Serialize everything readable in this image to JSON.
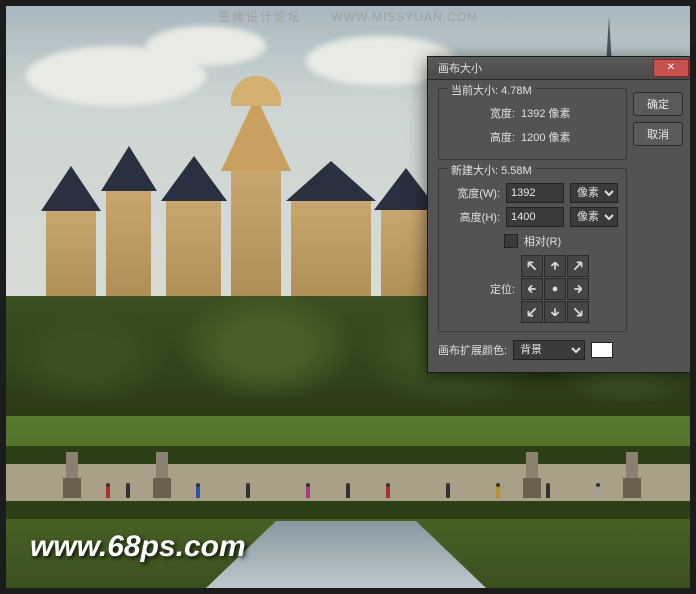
{
  "watermark": {
    "top_left": "思缘设计论坛",
    "top_right": "WWW.MISSYUAN.COM",
    "bottom": "www.68ps.com"
  },
  "dialog": {
    "title": "画布大小",
    "ok": "确定",
    "cancel": "取消",
    "current": {
      "heading": "当前大小:",
      "size": "4.78M",
      "width_label": "宽度:",
      "width_value": "1392 像素",
      "height_label": "高度:",
      "height_value": "1200 像素"
    },
    "new": {
      "heading": "新建大小:",
      "size": "5.58M",
      "width_label": "宽度(W):",
      "width_value": "1392",
      "width_unit": "像素",
      "height_label": "高度(H):",
      "height_value": "1400",
      "height_unit": "像素",
      "relative_label": "相对(R)",
      "anchor_label": "定位:"
    },
    "extension": {
      "label": "画布扩展颜色:",
      "value": "背景"
    }
  }
}
